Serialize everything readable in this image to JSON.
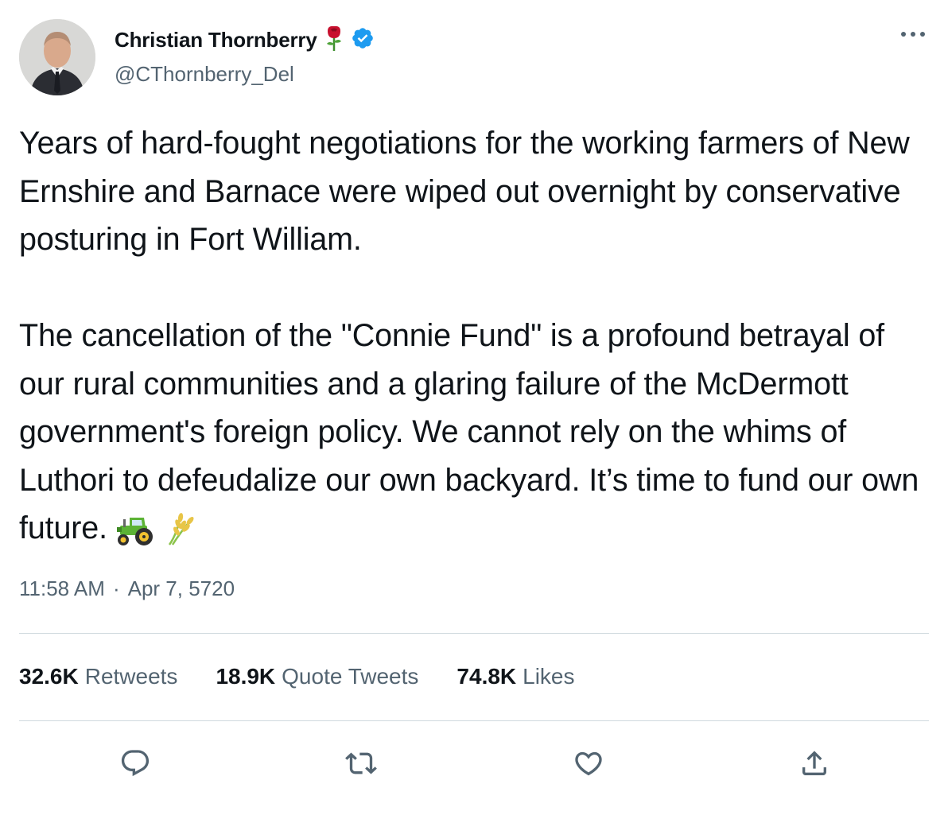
{
  "author": {
    "display_name": "Christian Thornberry",
    "handle": "@CThornberry_Del",
    "badge_icon": "rose-icon",
    "verified_icon": "verified-badge-icon",
    "verified_color": "#1d9bf0"
  },
  "tweet": {
    "text": "Years of hard-fought negotiations for the working farmers of New Ernshire and Barnace were wiped out overnight by conservative posturing in Fort William.\n\nThe cancellation of the \"Connie Fund\" is a profound betrayal of our rural communities and a glaring failure of the McDermott government's foreign policy. We cannot rely on the whims of Luthori to defeudalize our own backyard. It’s time to fund our own future.",
    "emojis": [
      "tractor-emoji",
      "rice-stalk-emoji"
    ],
    "time": "11:58 AM",
    "separator": "·",
    "date": "Apr 7, 5720"
  },
  "stats": {
    "retweets": {
      "count": "32.6K",
      "label": "Retweets"
    },
    "quote_tweets": {
      "count": "18.9K",
      "label": "Quote Tweets"
    },
    "likes": {
      "count": "74.8K",
      "label": "Likes"
    }
  },
  "actions": [
    "reply-icon",
    "retweet-icon",
    "like-icon",
    "share-icon"
  ],
  "colors": {
    "text": "#0f1419",
    "secondary": "#536471",
    "divider": "#cfd9de"
  }
}
